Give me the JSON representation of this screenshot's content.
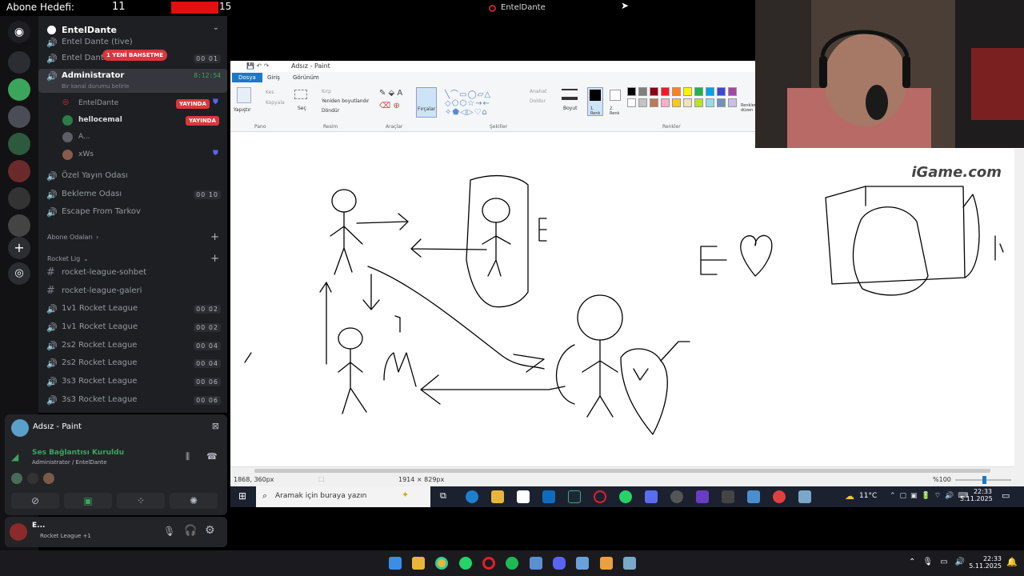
{
  "overlay": {
    "goal_label": "Abone Hedefi:",
    "goal_current": "11",
    "goal_target": "15",
    "goal_progress": 0.733,
    "window_title": "EntelDante"
  },
  "discord": {
    "server_name": "EntelDante",
    "notification_pill": "1 YENİ BAHSETME",
    "channels_top": [
      {
        "name": "Entel Dante (tive)",
        "icon": "speaker-icon"
      },
      {
        "name": "Entel Dante",
        "icon": "speaker-icon",
        "count": "00 01"
      }
    ],
    "active_channel": {
      "name": "Administrator",
      "time": "8:12:54",
      "status": "Bir kanal durumu belirle"
    },
    "users": [
      {
        "name": "EntelDante",
        "live": "YAYINDA"
      },
      {
        "name": "hellocemal",
        "live": "YAYINDA"
      },
      {
        "name": "A..."
      },
      {
        "name": "xWs"
      }
    ],
    "channels": [
      {
        "name": "Özel Yayın Odası",
        "icon": "speaker-icon"
      },
      {
        "name": "Bekleme Odası",
        "icon": "speaker-icon",
        "count": "00 10"
      },
      {
        "name": "Escape From Tarkov",
        "icon": "speaker-icon"
      }
    ],
    "categories": [
      {
        "name": "Abone Odaları"
      },
      {
        "name": "Rocket Lig"
      }
    ],
    "rocket_channels": [
      {
        "name": "rocket-league-sohbet",
        "icon": "#"
      },
      {
        "name": "rocket-league-galeri",
        "icon": "#"
      },
      {
        "name": "1v1 Rocket League",
        "count": "00 02"
      },
      {
        "name": "1v1 Rocket League",
        "count": "00 02"
      },
      {
        "name": "2s2 Rocket League",
        "count": "00 04"
      },
      {
        "name": "2s2 Rocket League",
        "count": "00 04"
      },
      {
        "name": "3s3 Rocket League",
        "count": "00 06"
      },
      {
        "name": "3s3 Rocket League",
        "count": "00 06"
      }
    ],
    "activity_title": "Adsız - Paint",
    "voice_status": "Ses Bağlantısı Kuruldu",
    "voice_sub": "Administrator / EntelDante",
    "user_name": "E...",
    "user_activity": "Rocket League +1"
  },
  "paint": {
    "title": "Adsız - Paint",
    "menu": [
      "Dosya",
      "Giriş",
      "Görünüm"
    ],
    "groups": [
      "Pano",
      "Resim",
      "Araçlar",
      "Şekiller",
      "Renkler"
    ],
    "tools": {
      "paste": "Yapıştır",
      "cut": "Kes",
      "copy": "Kopyala",
      "select": "Seç",
      "crop": "Kırp",
      "resize": "Yeniden boyutlandır",
      "rotate": "Döndür",
      "brushes": "Fırçalar",
      "outline": "Anahat",
      "fill": "Doldur",
      "size": "Boyut",
      "color1": "1. Renk",
      "color2": "2. Renk",
      "edit_colors": "Renkleri düzen"
    },
    "status_pos": "1868, 360px",
    "status_size": "1914 × 829px",
    "zoom": "%100",
    "palette": [
      "#000000",
      "#7f7f7f",
      "#880015",
      "#ed1c24",
      "#ff7f27",
      "#fff200",
      "#22b14c",
      "#00a2e8",
      "#3f48cc",
      "#a349a4",
      "#ffffff",
      "#c3c3c3",
      "#b97a57",
      "#ffaec9",
      "#ffc90e",
      "#efe4b0",
      "#b5e61d",
      "#99d9ea",
      "#7092be",
      "#c8bfe7"
    ]
  },
  "watermark": "iGame.com",
  "taskbar10": {
    "search": "Aramak için buraya yazın",
    "weather": "11°C",
    "time": "22:33",
    "date": "5.11.2025"
  },
  "taskbar11": {
    "time": "22:33",
    "date": "5.11.2025"
  }
}
